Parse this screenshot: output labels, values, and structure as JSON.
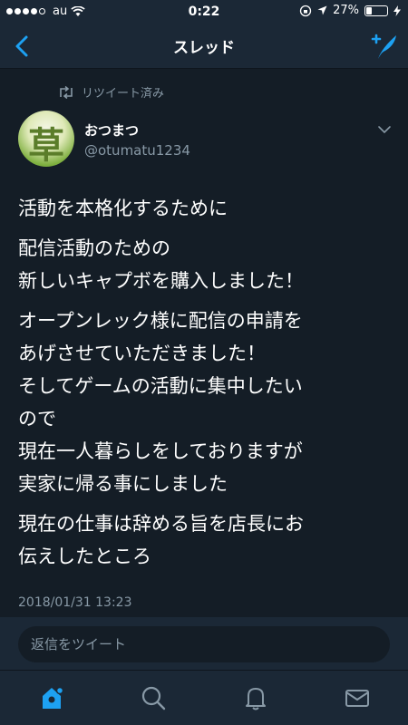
{
  "status_bar": {
    "carrier": "au",
    "time": "0:22",
    "battery": "27%",
    "battery_level": 0.27,
    "signal_bars": 4
  },
  "nav": {
    "title": "スレッド"
  },
  "tweet": {
    "retweet_label": "リツイート済み",
    "display_name": "おつまつ",
    "handle": "@otumatu1234",
    "avatar_text": "草",
    "paragraphs": [
      "活動を本格化するために",
      "配信活動のための\n新しいキャプボを購入しました！",
      "オープンレック様に配信の申請を\nあげさせていただきました！\nそしてゲームの活動に集中したい\nので\n現在一人暮らしをしておりますが\n実家に帰る事にしました",
      "現在の仕事は辞める旨を店長にお\n伝えしたところ"
    ],
    "timestamp": "2018/01/31 13:23"
  },
  "reply": {
    "placeholder": "返信をツイート"
  },
  "colors": {
    "background": "#141d26",
    "bar": "#1b2836",
    "accent": "#1da1f2",
    "muted": "#8899a6"
  },
  "tabs": [
    {
      "name": "home-icon"
    },
    {
      "name": "search-icon"
    },
    {
      "name": "notifications-icon"
    },
    {
      "name": "messages-icon"
    }
  ]
}
